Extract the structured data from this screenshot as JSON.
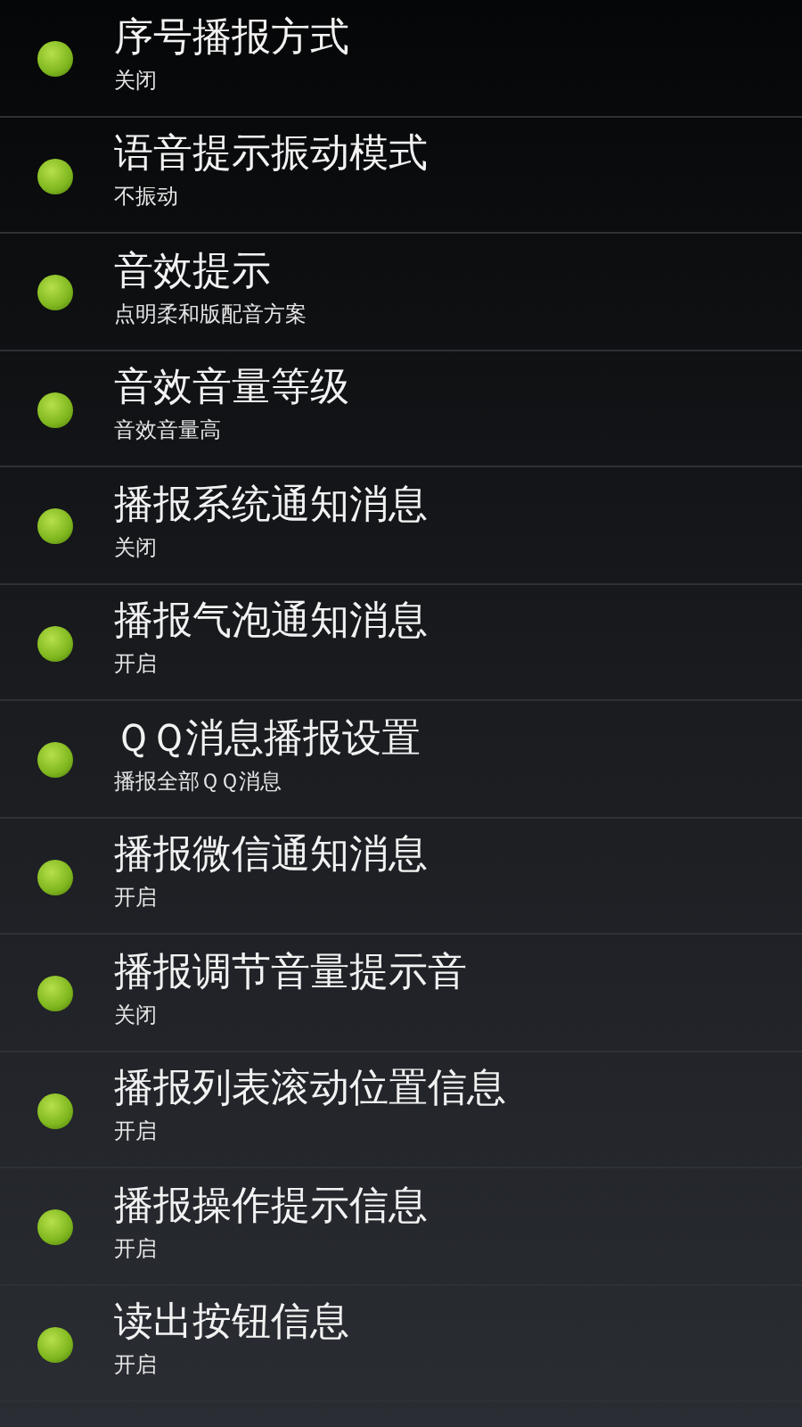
{
  "settings": [
    {
      "title": "序号播报方式",
      "summary": "关闭"
    },
    {
      "title": "语音提示振动模式",
      "summary": "不振动"
    },
    {
      "title": "音效提示",
      "summary": "点明柔和版配音方案"
    },
    {
      "title": "音效音量等级",
      "summary": "音效音量高"
    },
    {
      "title": "播报系统通知消息",
      "summary": "关闭"
    },
    {
      "title": "播报气泡通知消息",
      "summary": "开启"
    },
    {
      "title": "ＱＱ消息播报设置",
      "summary": "播报全部ＱＱ消息"
    },
    {
      "title": "播报微信通知消息",
      "summary": "开启"
    },
    {
      "title": "播报调节音量提示音",
      "summary": "关闭"
    },
    {
      "title": "播报列表滚动位置信息",
      "summary": "开启"
    },
    {
      "title": "播报操作提示信息",
      "summary": "开启"
    },
    {
      "title": "读出按钮信息",
      "summary": "开启"
    }
  ]
}
